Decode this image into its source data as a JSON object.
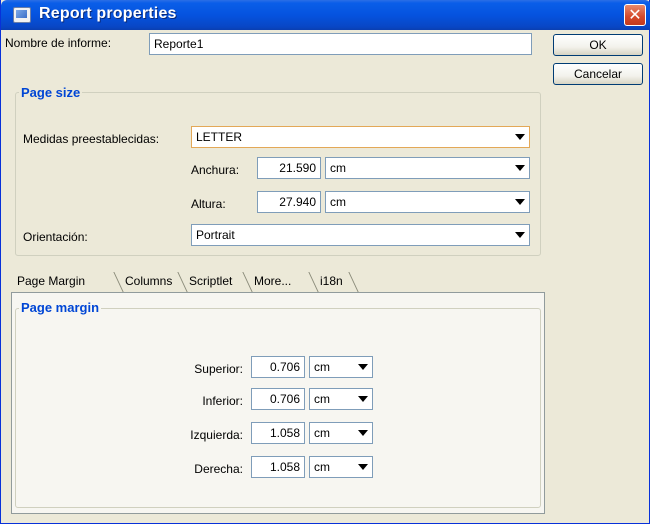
{
  "window": {
    "title": "Report properties"
  },
  "report_name": {
    "label": "Nombre de informe:",
    "value": "Reporte1"
  },
  "buttons": {
    "ok": "OK",
    "cancel": "Cancelar"
  },
  "page_size": {
    "title": "Page size",
    "preset_label": "Medidas preestablecidas:",
    "preset_value": "LETTER",
    "width_label": "Anchura:",
    "width_value": "21.590",
    "width_unit": "cm",
    "height_label": "Altura:",
    "height_value": "27.940",
    "height_unit": "cm",
    "orientation_label": "Orientación:",
    "orientation_value": "Portrait"
  },
  "tabs": [
    {
      "label": "Page Margin"
    },
    {
      "label": "Columns"
    },
    {
      "label": "Scriptlet"
    },
    {
      "label": "More..."
    },
    {
      "label": "i18n"
    }
  ],
  "page_margin": {
    "title": "Page margin",
    "rows": [
      {
        "label": "Superior:",
        "value": "0.706",
        "unit": "cm"
      },
      {
        "label": "Inferior:",
        "value": "0.706",
        "unit": "cm"
      },
      {
        "label": "Izquierda:",
        "value": "1.058",
        "unit": "cm"
      },
      {
        "label": "Derecha:",
        "value": "1.058",
        "unit": "cm"
      }
    ]
  },
  "colors": {
    "titlebar": "#0553df",
    "group_title": "#0046d5",
    "dialog_background": "#ece9d8"
  }
}
